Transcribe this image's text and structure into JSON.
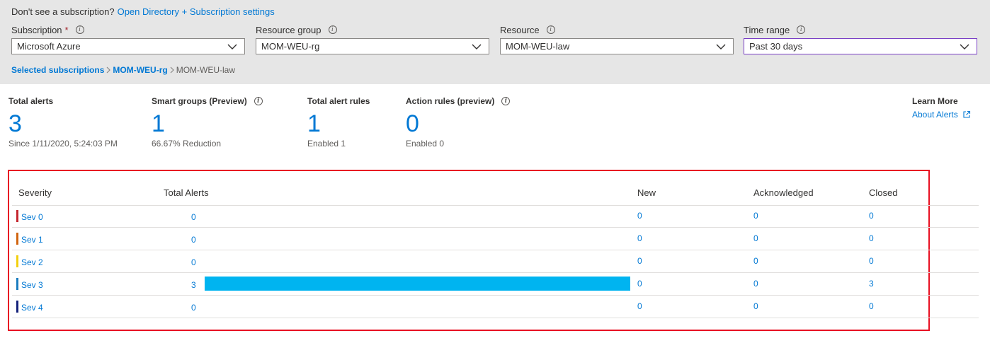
{
  "notice": {
    "text": "Don't see a subscription?",
    "link": "Open Directory + Subscription settings"
  },
  "filters": [
    {
      "label": "Subscription",
      "required": "*",
      "value": "Microsoft Azure"
    },
    {
      "label": "Resource group",
      "value": "MOM-WEU-rg"
    },
    {
      "label": "Resource",
      "value": "MOM-WEU-law"
    },
    {
      "label": "Time range",
      "value": "Past 30 days"
    }
  ],
  "breadcrumb": [
    "Selected subscriptions",
    "MOM-WEU-rg",
    "MOM-WEU-law"
  ],
  "stats": [
    {
      "title": "Total alerts",
      "value": "3",
      "sub": "Since 1/11/2020, 5:24:03 PM"
    },
    {
      "title": "Smart groups (Preview)",
      "value": "1",
      "sub": "66.67% Reduction"
    },
    {
      "title": "Total alert rules",
      "value": "1",
      "sub": "Enabled 1"
    },
    {
      "title": "Action rules (preview)",
      "value": "0",
      "sub": "Enabled 0"
    }
  ],
  "learn": {
    "title": "Learn More",
    "link": "About Alerts"
  },
  "table": {
    "headers": {
      "severity": "Severity",
      "total": "Total Alerts",
      "new": "New",
      "ack": "Acknowledged",
      "closed": "Closed"
    },
    "max_total": 3,
    "rows": [
      {
        "sev": "Sev 0",
        "color": "#c4262e",
        "total": "0",
        "total_value": 0,
        "new": "0",
        "ack": "0",
        "closed": "0"
      },
      {
        "sev": "Sev 1",
        "color": "#d1640f",
        "total": "0",
        "total_value": 0,
        "new": "0",
        "ack": "0",
        "closed": "0"
      },
      {
        "sev": "Sev 2",
        "color": "#f2d00e",
        "total": "0",
        "total_value": 0,
        "new": "0",
        "ack": "0",
        "closed": "0"
      },
      {
        "sev": "Sev 3",
        "color": "#1a7cbf",
        "total": "3",
        "total_value": 3,
        "new": "0",
        "ack": "0",
        "closed": "3"
      },
      {
        "sev": "Sev 4",
        "color": "#13217a",
        "total": "0",
        "total_value": 0,
        "new": "0",
        "ack": "0",
        "closed": "0"
      }
    ]
  },
  "colors": {
    "accent": "#0078d4",
    "bar": "#00b4f0",
    "highlight_border": "#e81123"
  }
}
